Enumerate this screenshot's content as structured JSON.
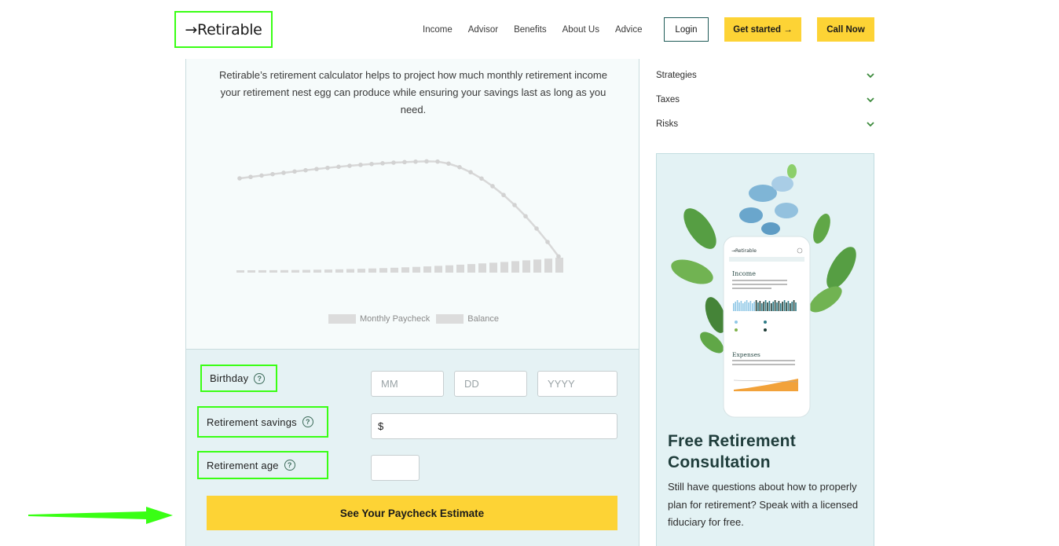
{
  "header": {
    "logo": "→Retirable",
    "nav": [
      "Income",
      "Advisor",
      "Benefits",
      "About Us",
      "Advice"
    ],
    "login_label": "Login",
    "get_started_label": "Get started →",
    "call_now_label": "Call Now"
  },
  "calculator": {
    "intro": "Retirable’s retirement calculator helps to project how much monthly retirement income your retirement nest egg can produce while ensuring your savings last as long as you need.",
    "legend": {
      "paycheck": "Monthly Paycheck",
      "balance": "Balance"
    },
    "form": {
      "birthday_label": "Birthday",
      "birthday_placeholders": {
        "month": "MM",
        "day": "DD",
        "year": "YYYY"
      },
      "savings_label": "Retirement savings",
      "savings_prefix": "$",
      "savings_value": "",
      "age_label": "Retirement age",
      "age_value": "",
      "submit_label": "See Your Paycheck Estimate"
    }
  },
  "sidebar": {
    "accordion": [
      {
        "label": "Strategies"
      },
      {
        "label": "Taxes"
      },
      {
        "label": "Risks"
      }
    ],
    "promo": {
      "title": "Free Retirement Consultation",
      "text": "Still have questions about how to properly plan for retirement? Speak with a licensed fiduciary for free.",
      "phone_app_logo": "→Retirable",
      "phone_app_headline": "Income",
      "phone_app_headline_2": "Expenses"
    }
  },
  "colors": {
    "accent_yellow": "#fdd335",
    "highlight_green": "#39ff14",
    "teal_dark": "#1e5a57",
    "panel_bg": "#e5f2f4"
  },
  "icons": {
    "help": "help-circle-icon",
    "chevron": "chevron-down-icon",
    "annotation_arrow": "arrow-right-icon"
  }
}
